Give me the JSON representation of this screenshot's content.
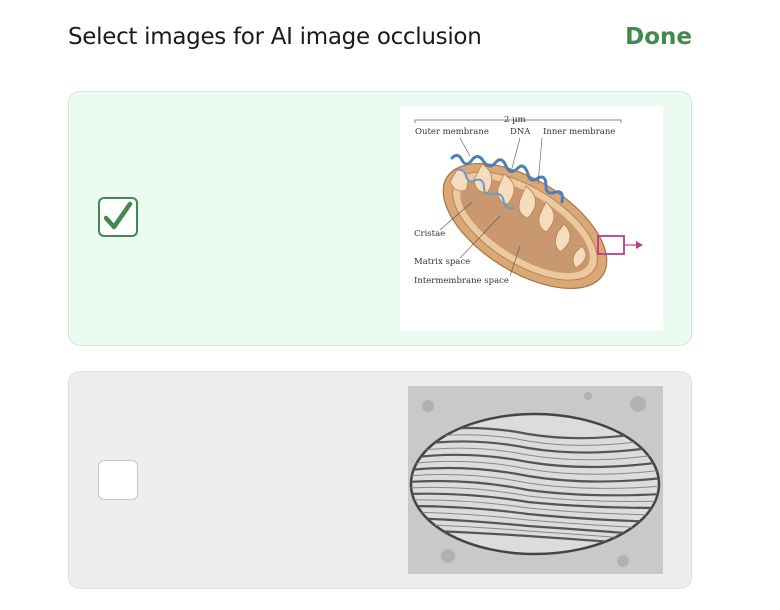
{
  "header": {
    "title": "Select images for AI image occlusion",
    "done_label": "Done"
  },
  "cards": [
    {
      "selected": true,
      "image": {
        "type": "mitochondrion-diagram",
        "scale_label": "2 µm",
        "labels": {
          "outer_membrane": "Outer membrane",
          "dna": "DNA",
          "inner_membrane": "Inner membrane",
          "cristae": "Cristae",
          "matrix_space": "Matrix space",
          "intermembrane_space": "Intermembrane space"
        }
      }
    },
    {
      "selected": false,
      "image": {
        "type": "mitochondrion-micrograph"
      }
    }
  ],
  "colors": {
    "accent": "#3f8a4c",
    "selected_card_bg": "#ecfbf1",
    "unselected_card_bg": "#eceeef"
  }
}
